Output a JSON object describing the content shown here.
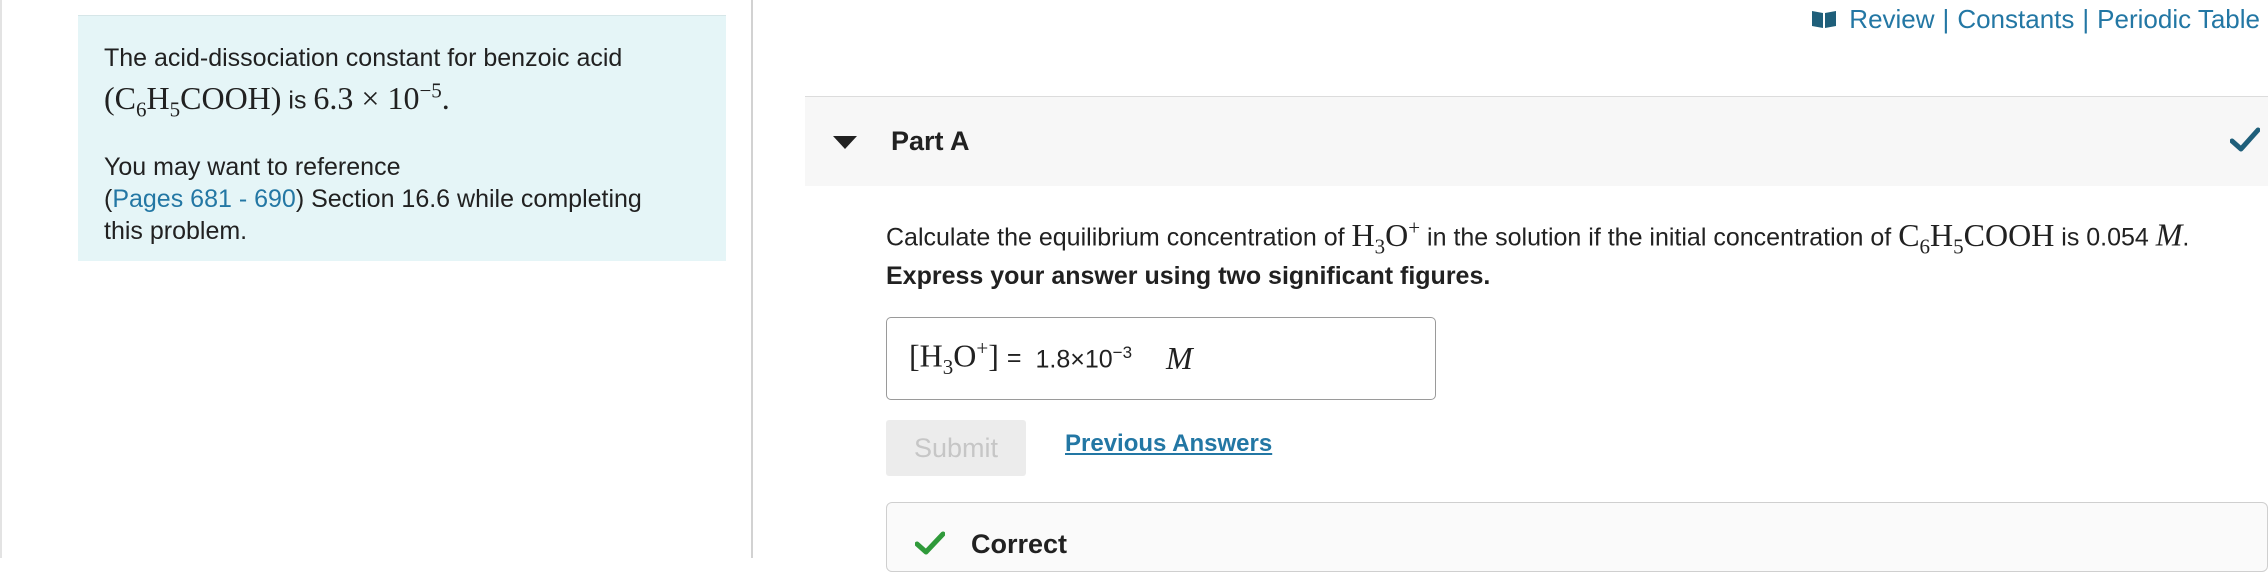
{
  "info_panel": {
    "line1": "The acid-dissociation constant for benzoic acid",
    "formula_open": "(C",
    "formula_sub1": "6",
    "formula_mid": "H",
    "formula_sub2": "5",
    "formula_end": "COOH)",
    "is_text": " is ",
    "constant": "6.3 × 10",
    "constant_exp": "−5",
    "period": ".",
    "reference_prefix": "You may want to reference",
    "reference_open": "(",
    "reference_link": "Pages 681 - 690",
    "reference_suffix": ") Section 16.6 while completing",
    "reference_end": "this problem."
  },
  "top_links": {
    "review": "Review",
    "sep1": "|",
    "constants": "Constants",
    "sep2": "|",
    "periodic_table": "Periodic Table"
  },
  "part": {
    "title": "Part A"
  },
  "question": {
    "prefix": "Calculate the equilibrium concentration of ",
    "h3o": "H",
    "h3o_sub": "3",
    "h3o_o": "O",
    "h3o_sup": "+",
    "middle": " in the solution if the initial concentration of ",
    "acid_c": "C",
    "acid_sub1": "6",
    "acid_h": "H",
    "acid_sub2": "5",
    "acid_rest": "COOH",
    "suffix": " is 0.054 ",
    "unit": "M",
    "end": "."
  },
  "instruction": "Express your answer using two significant figures.",
  "answer": {
    "lhs_open": "[H",
    "lhs_sub": "3",
    "lhs_o": "O",
    "lhs_sup": "+",
    "lhs_close": "]",
    "equals": "=",
    "value_mantissa": "1.8×10",
    "value_exp": "−3",
    "unit": "M"
  },
  "buttons": {
    "submit": "Submit",
    "previous_answers": "Previous Answers"
  },
  "feedback": {
    "label": "Correct"
  },
  "colors": {
    "link": "#2377a4",
    "panel_bg": "#e5f5f7",
    "check_header": "#1f5f7a",
    "check_correct": "#2f9a3a"
  }
}
